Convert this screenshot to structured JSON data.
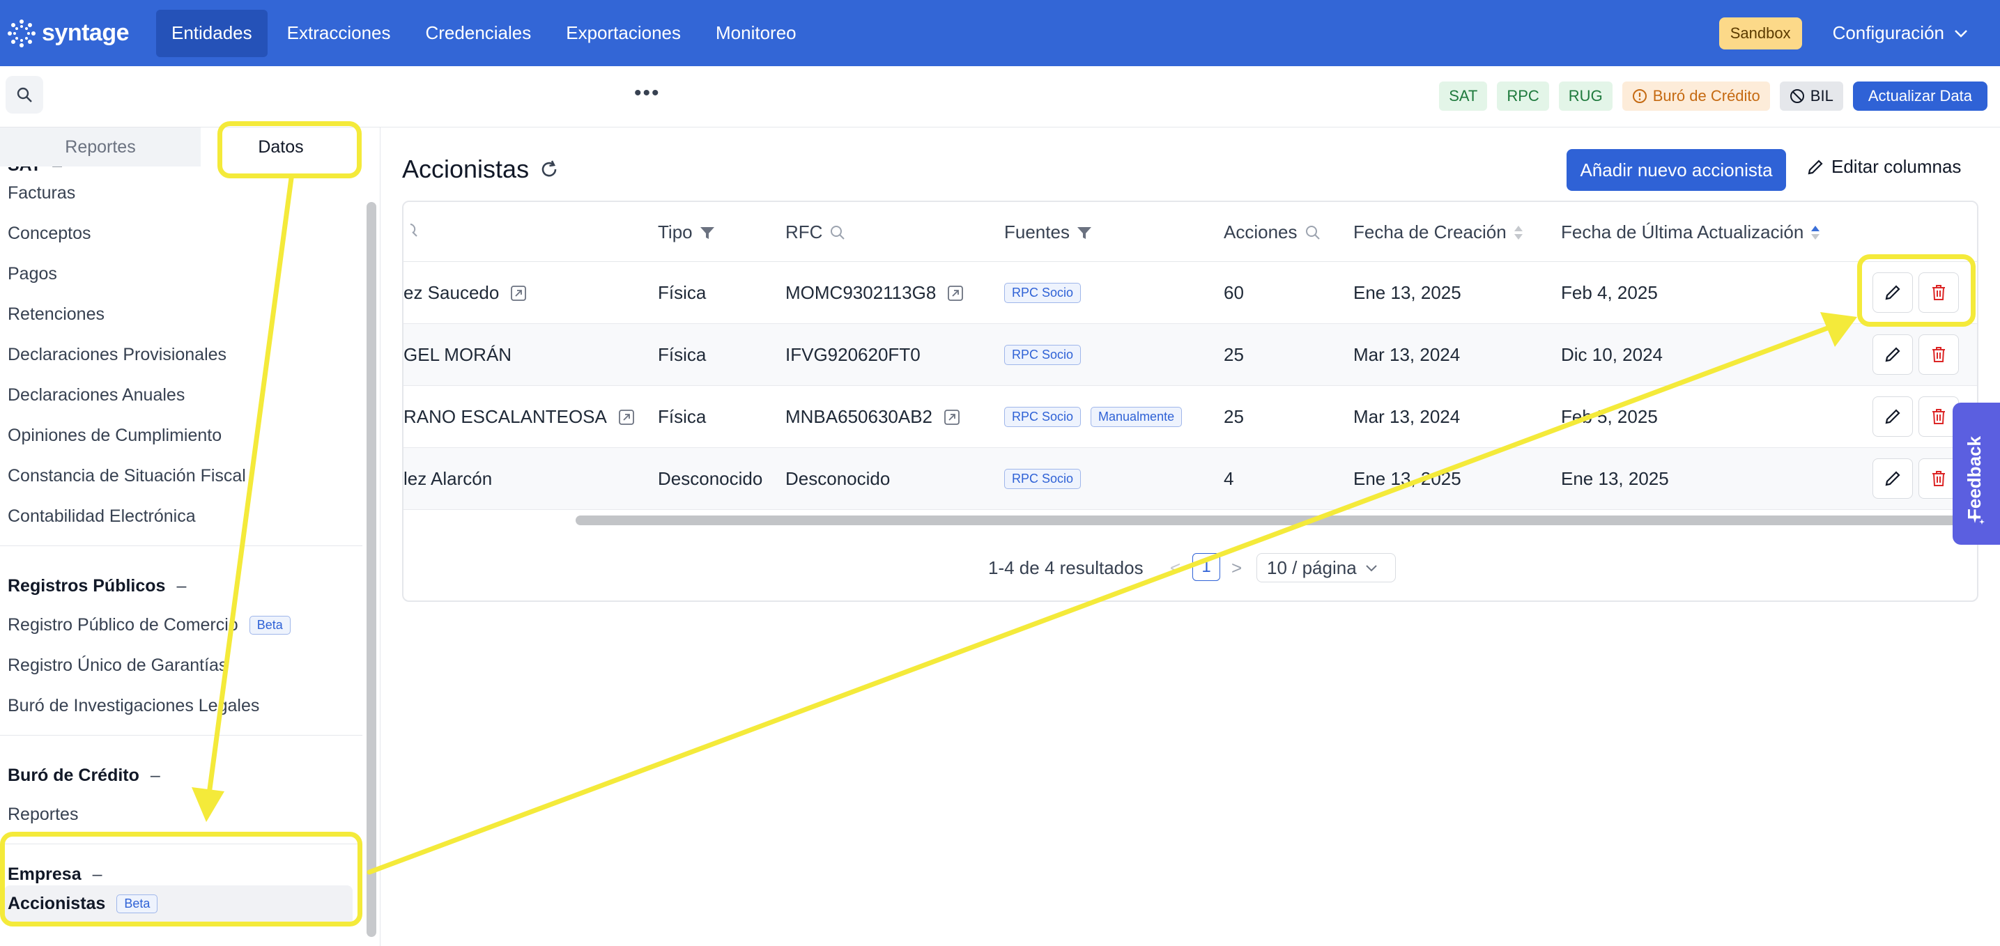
{
  "brand": {
    "name": "syntage"
  },
  "nav": {
    "items": [
      "Entidades",
      "Extracciones",
      "Credenciales",
      "Exportaciones",
      "Monitoreo"
    ],
    "sandbox": "Sandbox",
    "config": "Configuración"
  },
  "toolbar": {
    "dots": "•••",
    "sources": [
      "SAT",
      "RPC",
      "RUG",
      "Buró de Crédito",
      "BIL"
    ],
    "update_label": "Actualizar Data"
  },
  "sidebar": {
    "tabs": [
      "Reportes",
      "Datos"
    ],
    "sat": {
      "heading": "SAT",
      "items": [
        "Facturas",
        "Conceptos",
        "Pagos",
        "Retenciones",
        "Declaraciones Provisionales",
        "Declaraciones Anuales",
        "Opiniones de Cumplimiento",
        "Constancia de Situación Fiscal",
        "Contabilidad Electrónica"
      ]
    },
    "registros": {
      "heading": "Registros Públicos",
      "items": [
        "Registro Público de Comercio",
        "Registro Único de Garantías",
        "Buró de Investigaciones Legales"
      ],
      "beta": "Beta"
    },
    "buro": {
      "heading": "Buró de Crédito",
      "items": [
        "Reportes"
      ]
    },
    "empresa": {
      "heading": "Empresa",
      "items": [
        "Accionistas"
      ],
      "beta": "Beta"
    },
    "minus": "–"
  },
  "main": {
    "title": "Accionistas",
    "add_button": "Añadir nuevo accionista",
    "edit_columns": "Editar columnas",
    "columns": [
      "Tipo",
      "RFC",
      "Fuentes",
      "Acciones",
      "Fecha de Creación",
      "Fecha de Última Actualización"
    ],
    "rows": [
      {
        "name": "ez Saucedo",
        "tipo": "Física",
        "rfc": "MOMC9302113G8",
        "fuentes": [
          "RPC Socio"
        ],
        "acciones": "60",
        "creacion": "Ene 13, 2025",
        "actualizacion": "Feb 4, 2025"
      },
      {
        "name": "GEL MORÁN",
        "tipo": "Física",
        "rfc": "IFVG920620FT0",
        "fuentes": [
          "RPC Socio"
        ],
        "acciones": "25",
        "creacion": "Mar 13, 2024",
        "actualizacion": "Dic 10, 2024"
      },
      {
        "name": "RANO ESCALANTEOSA",
        "tipo": "Física",
        "rfc": "MNBA650630AB2",
        "fuentes": [
          "RPC Socio",
          "Manualmente"
        ],
        "acciones": "25",
        "creacion": "Mar 13, 2024",
        "actualizacion": "Feb 5, 2025"
      },
      {
        "name": "lez Alarcón",
        "tipo": "Desconocido",
        "rfc": "Desconocido",
        "fuentes": [
          "RPC Socio"
        ],
        "acciones": "4",
        "creacion": "Ene 13, 2025",
        "actualizacion": "Ene 13, 2025"
      }
    ],
    "pagination": {
      "summary": "1-4 de 4 resultados",
      "prev": "<",
      "page": "1",
      "next": ">",
      "page_size": "10 / página"
    }
  },
  "feedback": {
    "label": "Feedback"
  },
  "colors": {
    "brand": "#3366d6",
    "highlight": "#f4ea3a",
    "danger": "#dc2626"
  }
}
